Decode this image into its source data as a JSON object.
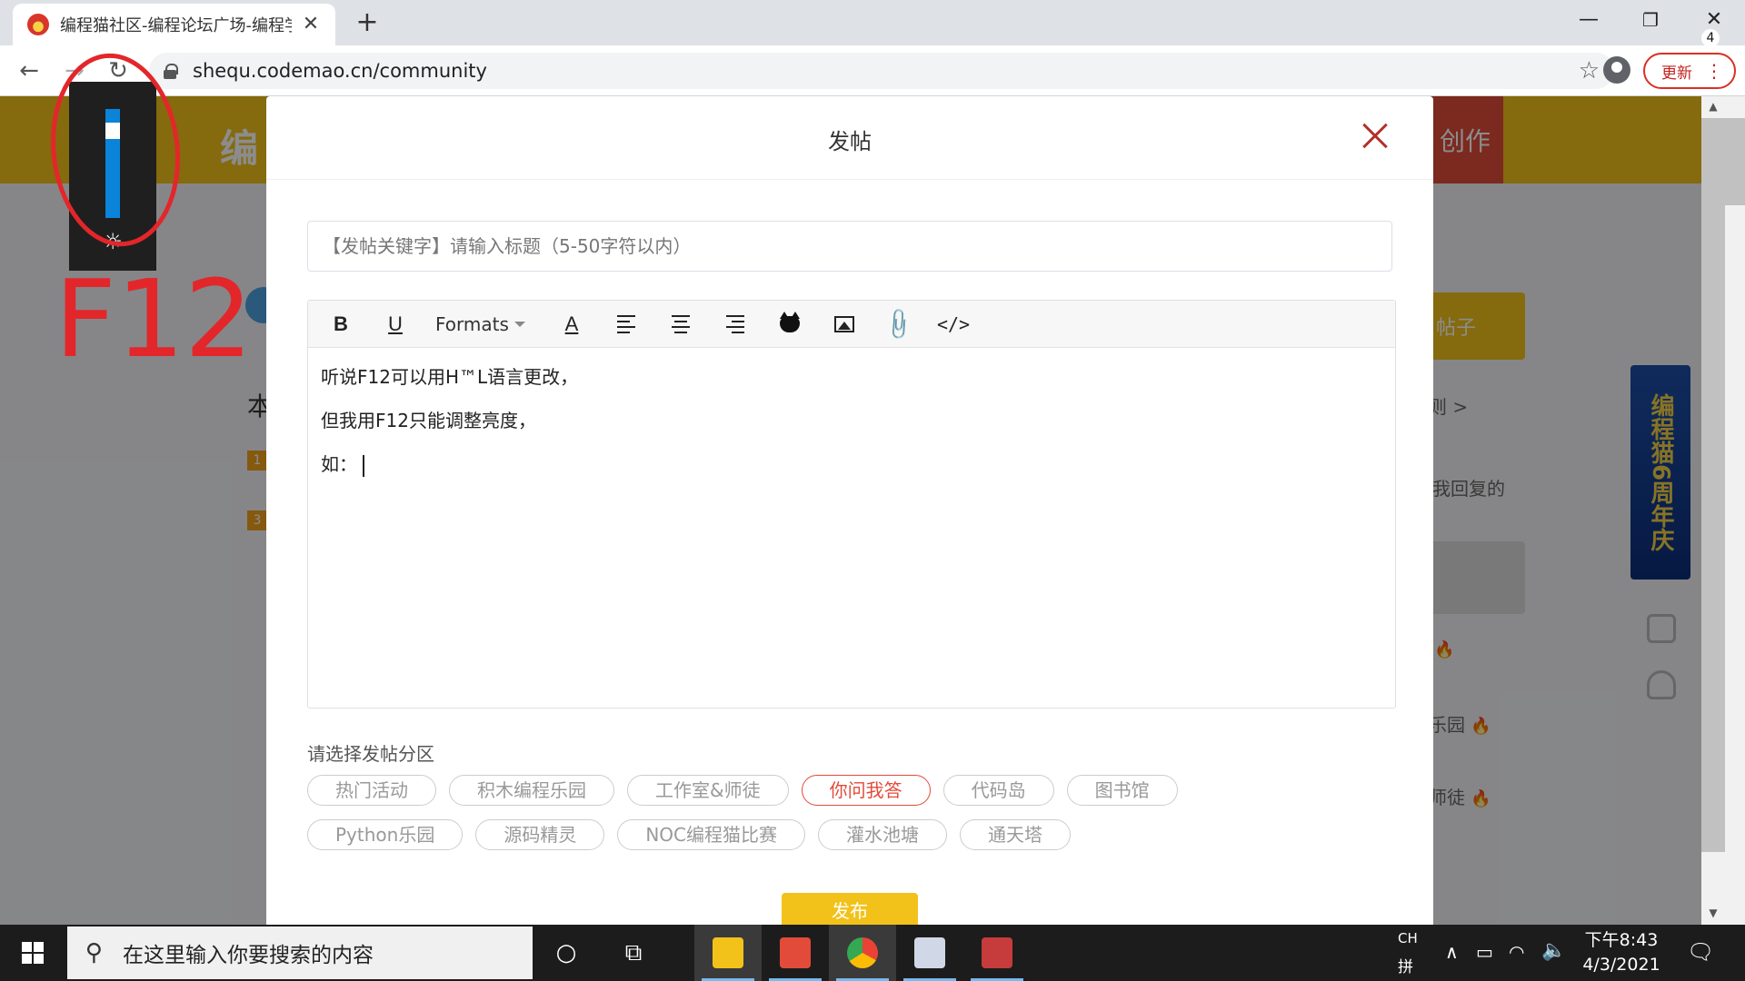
{
  "browser": {
    "tab_title": "编程猫社区-编程论坛广场-编程学",
    "tab_close": "✕",
    "new_tab": "+",
    "window_controls": {
      "minimize": "—",
      "maximize": "❐",
      "close": "✕"
    },
    "url": "shequ.codemao.cn/community",
    "update_label": "更新"
  },
  "page": {
    "logo_text": "编",
    "create_label": "创作",
    "side_post_label": "帖子",
    "side_rules": "则 >",
    "side_my_reply": "我回复的",
    "side_items": [
      "乐园",
      "师徒"
    ],
    "left_ben": "本",
    "left_tags": [
      "1",
      "3"
    ],
    "banner_text": "编程猫6周年庆"
  },
  "modal": {
    "title": "发帖",
    "title_placeholder": "【发帖关键字】请输入标题（5-50字符以内）",
    "toolbar": {
      "bold": "B",
      "underline": "U",
      "formats": "Formats",
      "font_color": "A",
      "code": "</>"
    },
    "body_lines": [
      "听说F12可以用H™L语言更改，",
      "但我用F12只能调整亮度，",
      "如："
    ],
    "section_label": "请选择发帖分区",
    "categories_row1": [
      "热门活动",
      "积木编程乐园",
      "工作室&师徒",
      "你问我答",
      "代码岛",
      "图书馆"
    ],
    "categories_row2": [
      "Python乐园",
      "源码精灵",
      "NOC编程猫比赛",
      "灌水池塘",
      "通天塔"
    ],
    "selected_category": "你问我答",
    "publish_label": "发布"
  },
  "brightness": {
    "level_percent": 85
  },
  "annotation": {
    "text": "F12"
  },
  "taskbar": {
    "search_placeholder": "在这里输入你要搜索的内容",
    "ime_lang": "CH",
    "ime_mode": "拼",
    "time": "下午8:43",
    "date": "4/3/2021",
    "notification_count": "4"
  },
  "colors": {
    "site_yellow": "#f2c21a",
    "accent_red": "#e24b3a",
    "brightness_blue": "#0a84d8"
  }
}
